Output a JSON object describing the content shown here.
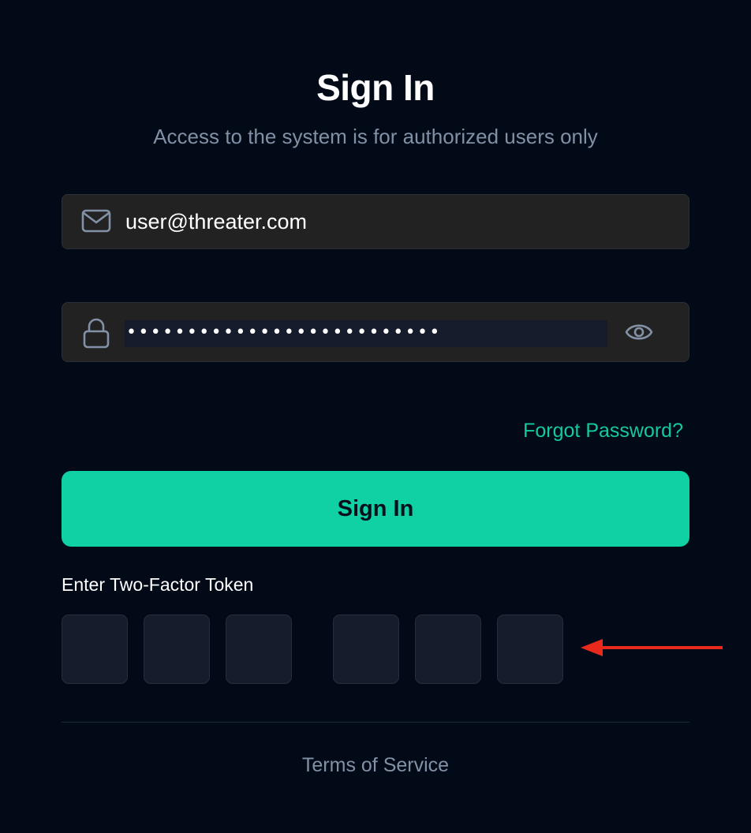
{
  "header": {
    "title": "Sign In",
    "subtitle": "Access to the system is for authorized users only"
  },
  "form": {
    "email": {
      "icon": "envelope-icon",
      "value": "user@threater.com"
    },
    "password": {
      "icon": "lock-icon",
      "masked_value": "••••••••••••••••••••••••••",
      "toggle_icon": "eye-icon"
    },
    "forgot_password_label": "Forgot Password?",
    "submit_label": "Sign In"
  },
  "two_factor": {
    "label": "Enter Two-Factor Token",
    "digits": [
      "",
      "",
      "",
      "",
      "",
      ""
    ]
  },
  "annotation": {
    "icon": "red-arrow-icon",
    "color": "#e8291c"
  },
  "footer": {
    "terms_label": "Terms of Service"
  },
  "colors": {
    "background": "#020a17",
    "accent": "#10d1a4",
    "link": "#14c9a0",
    "muted_text": "#8290a6",
    "field_bg": "#222222",
    "token_box_bg": "#161c2b"
  }
}
